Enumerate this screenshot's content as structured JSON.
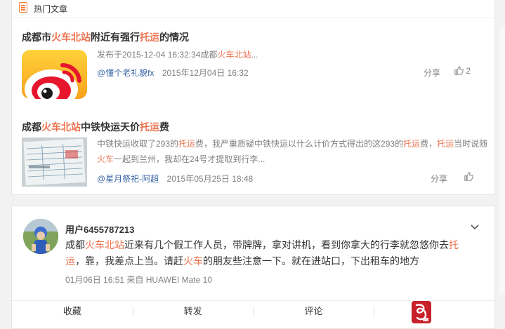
{
  "section": {
    "title": "热门文章"
  },
  "articles": [
    {
      "title_parts": [
        "成都市",
        "火车北站",
        "附近有强行",
        "托运",
        "的情况"
      ],
      "excerpt_parts": [
        "发布于2015-12-04 16:32:34成都",
        "火车北站",
        "..."
      ],
      "author": "@懂个老礼貌fx",
      "date": "2015年12月04日 16:32",
      "share": "分享",
      "likes": "2"
    },
    {
      "title_parts": [
        "成都",
        "火车北站",
        "中铁快运天价",
        "托运",
        "费"
      ],
      "excerpt_parts": [
        "中铁快运收取了293的",
        "托运",
        "费，我严重质疑中铁快运以什么计价方式得出的这293的",
        "托运",
        "费，",
        "托运",
        "当时说随",
        "火车",
        "一起到兰州，我却在24号才提取到行李..."
      ],
      "author": "@星月祭祀-阿超",
      "date": "2015年05月25日 18:48",
      "share": "分享",
      "likes": ""
    }
  ],
  "post": {
    "username": "用户6455787213",
    "text_parts": [
      "成都",
      "火车北站",
      "近来有几个假工作人员，带牌牌，拿对讲机，看到你拿大的行李就忽悠你去",
      "托运",
      "，靠，我差点上当。请赶",
      "火车",
      "的朋友些注意一下。就在进站口，下出租车的地方"
    ],
    "timestamp": "01月06日 16:51",
    "via": "来自 HUAWEI Mate 10",
    "actions": [
      "收藏",
      "转发",
      "评论"
    ]
  },
  "colors": {
    "highlight": "#eb7350",
    "link": "#3a66a8",
    "muted": "#808080",
    "accent": "#fa7d3c"
  }
}
